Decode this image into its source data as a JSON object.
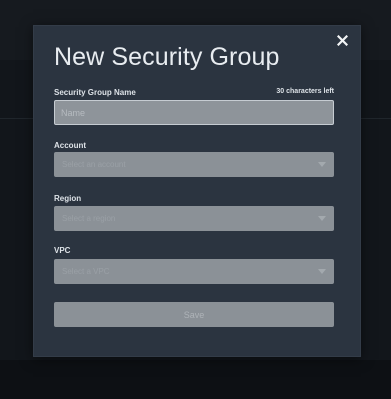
{
  "modal": {
    "title": "New Security Group",
    "close_icon": "close-icon",
    "name_field": {
      "label": "Security Group Name",
      "chars_left": "30 characters left",
      "placeholder": "Name",
      "value": ""
    },
    "account_field": {
      "label": "Account",
      "selected": "Select an account",
      "icon": "chevron-down-icon"
    },
    "region_field": {
      "label": "Region",
      "selected": "Select a region",
      "icon": "chevron-down-icon"
    },
    "vpc_field": {
      "label": "VPC",
      "selected": "Select a VPC",
      "icon": "chevron-down-icon"
    },
    "save_label": "Save"
  },
  "colors": {
    "modal_bg": "#2b3440",
    "input_bg": "#8b9197",
    "title_text": "#e8ecf0"
  }
}
